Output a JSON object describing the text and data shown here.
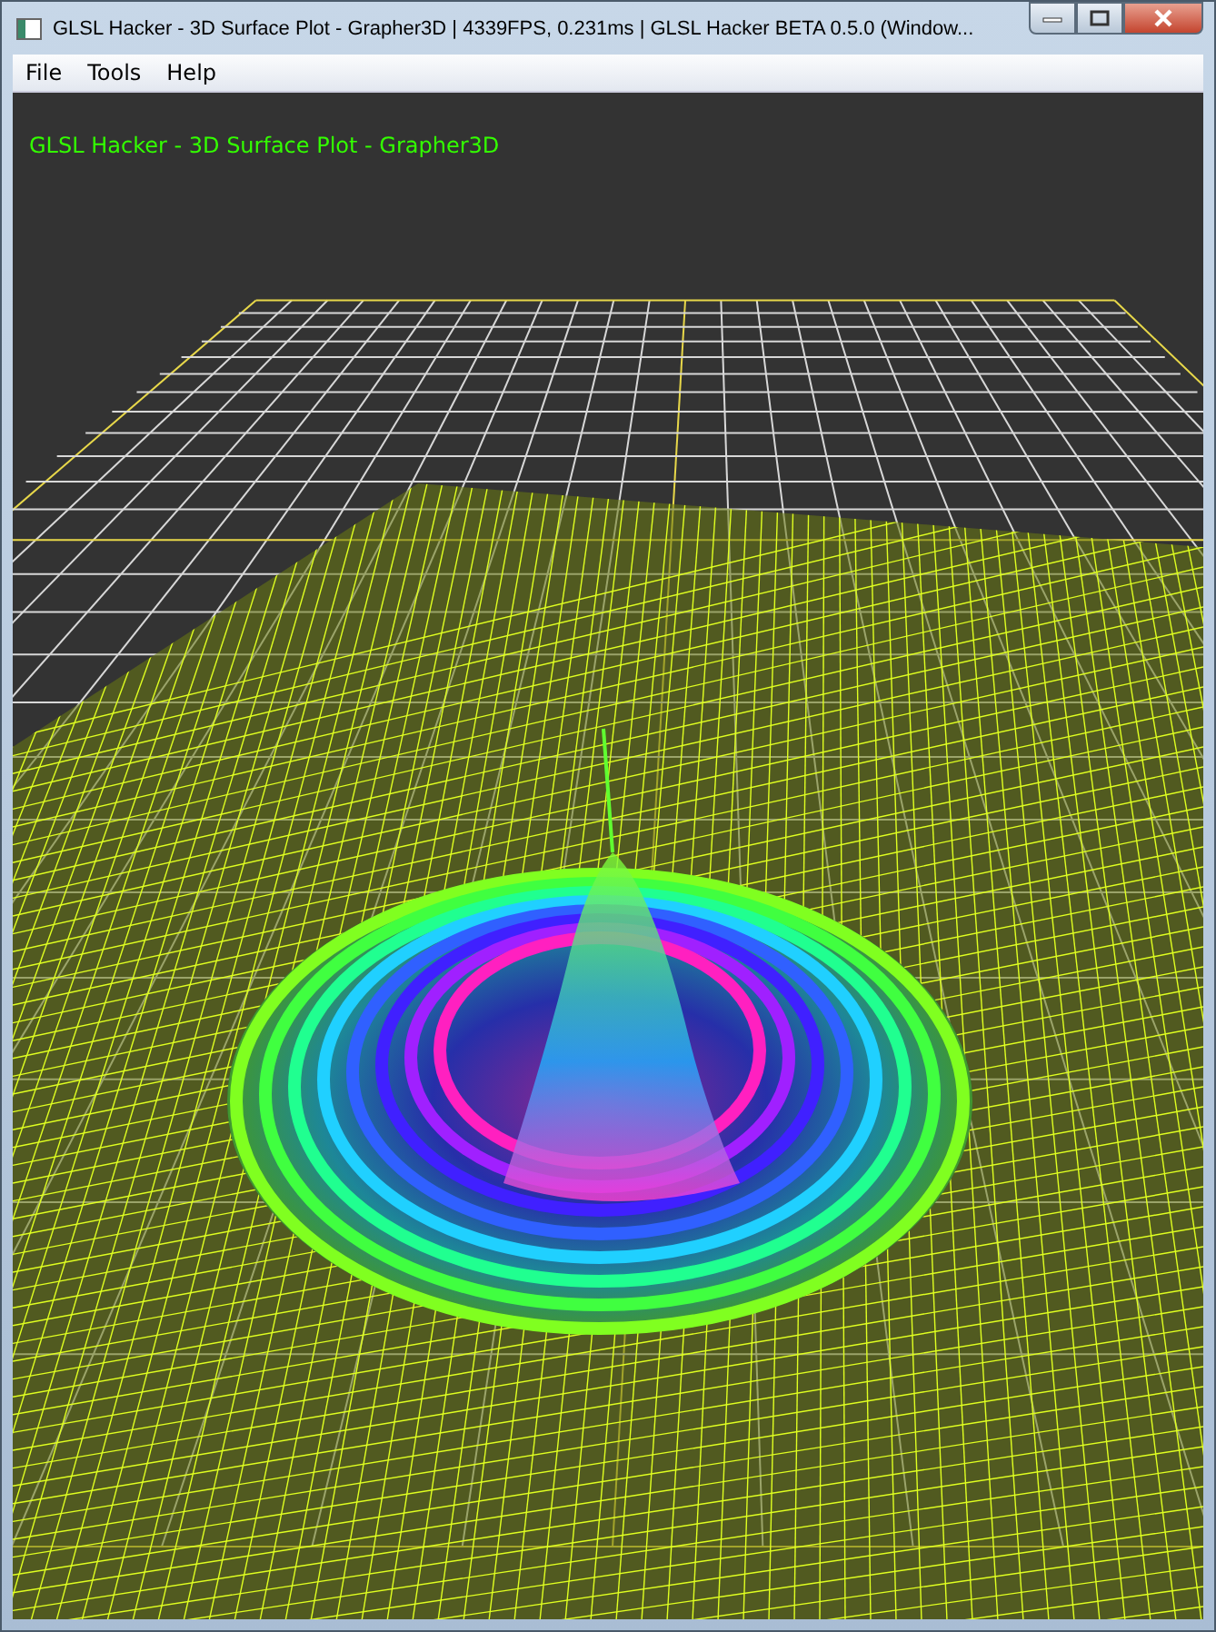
{
  "window": {
    "title": "GLSL Hacker - 3D Surface Plot - Grapher3D | 4339FPS, 0.231ms | GLSL Hacker BETA 0.5.0 (Window..."
  },
  "menu": [
    "File",
    "Tools",
    "Help"
  ],
  "viewport": {
    "overlay_text": "GLSL Hacker - 3D Surface Plot - Grapher3D"
  }
}
